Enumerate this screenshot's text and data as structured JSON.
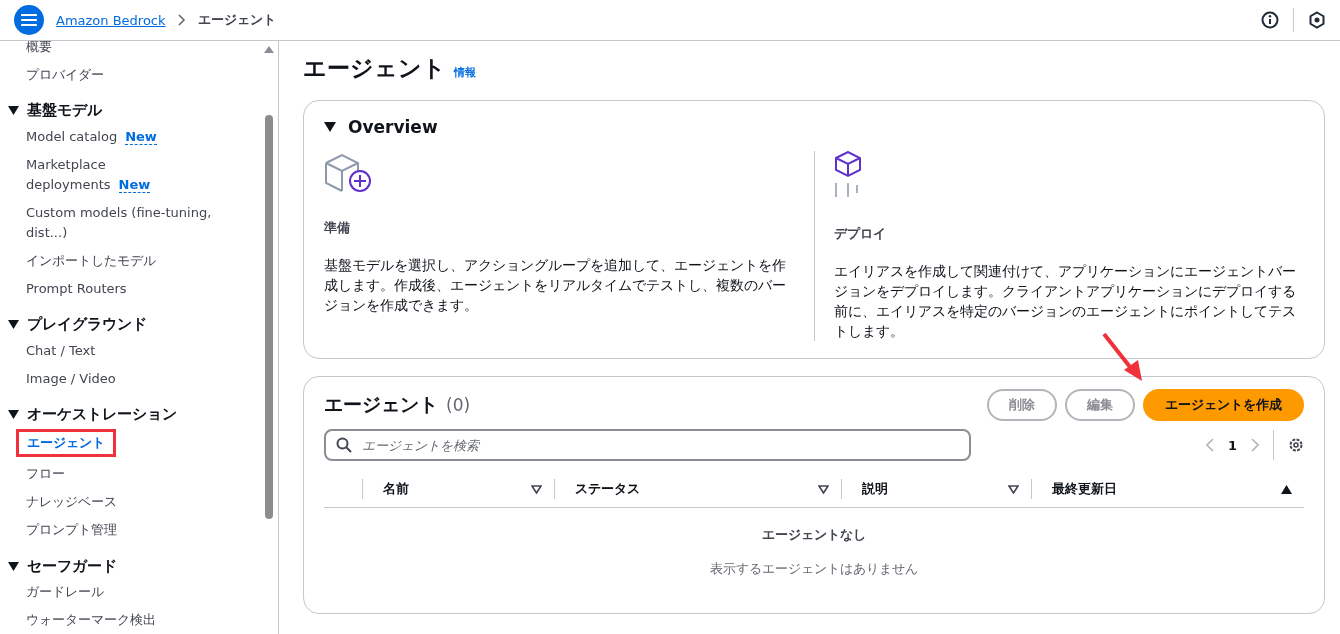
{
  "header": {
    "breadcrumbs": [
      {
        "label": "Amazon Bedrock",
        "kind": "link"
      },
      {
        "label": "エージェント",
        "kind": "current"
      }
    ]
  },
  "sidebar": {
    "sections": [
      {
        "items": [
          {
            "label": "概要",
            "selected": false
          },
          {
            "label": "プロバイダー",
            "selected": false
          }
        ]
      },
      {
        "title": "基盤モデル",
        "expanded": true,
        "items": [
          {
            "label": "Model catalog",
            "badge": "New",
            "selected": false
          },
          {
            "label": "Marketplace deployments",
            "badge": "New",
            "selected": false
          },
          {
            "label": "Custom models (fine-tuning, dist...)",
            "selected": false
          },
          {
            "label": "インポートしたモデル",
            "selected": false
          },
          {
            "label": "Prompt Routers",
            "selected": false
          }
        ]
      },
      {
        "title": "プレイグラウンド",
        "expanded": true,
        "items": [
          {
            "label": "Chat / Text",
            "selected": false
          },
          {
            "label": "Image / Video",
            "selected": false
          }
        ]
      },
      {
        "title": "オーケストレーション",
        "expanded": true,
        "items": [
          {
            "label": "エージェント",
            "selected": true,
            "annotated": true
          },
          {
            "label": "フロー",
            "selected": false
          },
          {
            "label": "ナレッジベース",
            "selected": false
          },
          {
            "label": "プロンプト管理",
            "selected": false
          }
        ]
      },
      {
        "title": "セーフガード",
        "expanded": true,
        "items": [
          {
            "label": "ガードレール",
            "selected": false
          },
          {
            "label": "ウォーターマーク検出",
            "selected": false
          }
        ]
      }
    ]
  },
  "page": {
    "title": "エージェント",
    "info_link": "情報"
  },
  "overview": {
    "title": "Overview",
    "expanded": true,
    "steps": [
      {
        "kind": "build",
        "title": "準備",
        "text": "基盤モデルを選択し、アクショングループを追加して、エージェントを作成します。作成後、エージェントをリアルタイムでテストし、複数のバージョンを作成できます。"
      },
      {
        "kind": "deploy",
        "title": "デプロイ",
        "text": "エイリアスを作成して関連付けて、アプリケーションにエージェントバージョンをデプロイします。クライアントアプリケーションにデプロイする前に、エイリアスを特定のバージョンのエージェントにポイントしてテストします。"
      }
    ]
  },
  "agents_table": {
    "title": "エージェント",
    "count": "(0)",
    "buttons": [
      {
        "label": "削除",
        "kind": "normal",
        "disabled": true
      },
      {
        "label": "編集",
        "kind": "normal",
        "disabled": true
      },
      {
        "label": "エージェントを作成",
        "kind": "primary",
        "annotated": true
      }
    ],
    "search": {
      "placeholder": "エージェントを検索"
    },
    "pagination": {
      "page": "1"
    },
    "columns": [
      {
        "label": "名前",
        "sorted": false
      },
      {
        "label": "ステータス",
        "sorted": false
      },
      {
        "label": "説明",
        "sorted": false
      },
      {
        "label": "最終更新日",
        "sorted": true
      }
    ],
    "empty": {
      "title": "エージェントなし",
      "text": "表示するエージェントはありません"
    }
  }
}
